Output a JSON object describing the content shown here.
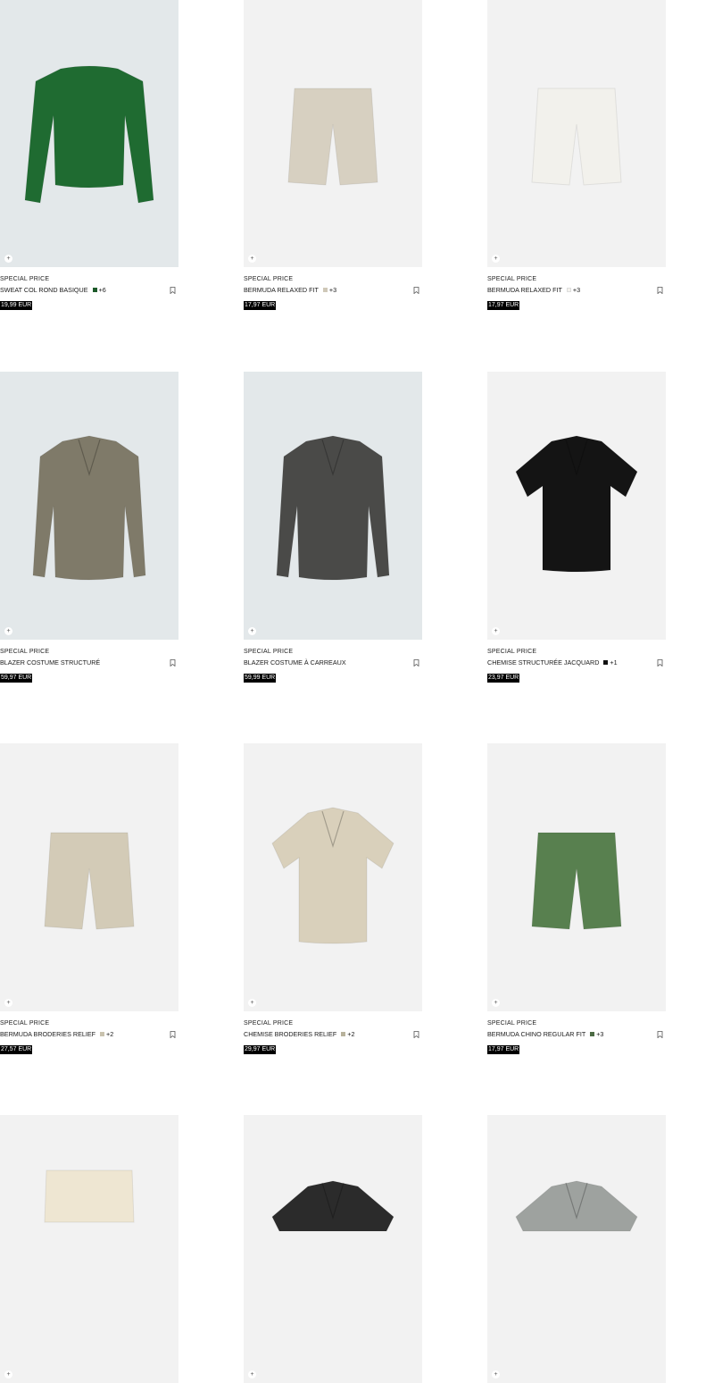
{
  "bookmark_icon": "bookmark-icon",
  "add_icon": "plus-icon",
  "products": [
    {
      "tag": "SPECIAL PRICE",
      "name": "SWEAT COL ROND BASIQUE",
      "swatch": "#1d5a2a",
      "more": "+6",
      "price": "19,99 EUR",
      "garment": "sweater",
      "color": "#1f6b31",
      "bg": "blue"
    },
    {
      "tag": "SPECIAL PRICE",
      "name": "BERMUDA RELAXED FIT",
      "swatch": "#cfc8b8",
      "more": "+3",
      "price": "17,97 EUR",
      "garment": "shorts",
      "color": "#d7d0c1",
      "bg": "grey"
    },
    {
      "tag": "SPECIAL PRICE",
      "name": "BERMUDA RELAXED FIT",
      "swatch": "#f4f3ee",
      "more": "+3",
      "price": "17,97 EUR",
      "garment": "shorts",
      "color": "#f2f1ec",
      "bg": "grey"
    },
    {
      "tag": "SPECIAL PRICE",
      "name": "BLAZER COSTUME STRUCTURÉ",
      "swatch": "",
      "more": "",
      "price": "59,97 EUR",
      "garment": "blazer",
      "color": "#7f7a69",
      "bg": "blue"
    },
    {
      "tag": "SPECIAL PRICE",
      "name": "BLAZER COSTUME À CARREAUX",
      "swatch": "",
      "more": "",
      "price": "59,99 EUR",
      "garment": "blazer",
      "color": "#4a4a48",
      "bg": "blue"
    },
    {
      "tag": "SPECIAL PRICE",
      "name": "CHEMISE STRUCTURÉE JACQUARD",
      "swatch": "#111111",
      "more": "+1",
      "price": "23,97 EUR",
      "garment": "shirt",
      "color": "#141414",
      "bg": "grey"
    },
    {
      "tag": "SPECIAL PRICE",
      "name": "BERMUDA BRODERIES RELIEF",
      "swatch": "#c9c2ae",
      "more": "+2",
      "price": "27,57 EUR",
      "garment": "shorts",
      "color": "#d3cbb7",
      "bg": "grey"
    },
    {
      "tag": "SPECIAL PRICE",
      "name": "CHEMISE BRODERIES RELIEF",
      "swatch": "#b8b29c",
      "more": "+2",
      "price": "29,97 EUR",
      "garment": "shirt",
      "color": "#d9d0bb",
      "bg": "grey"
    },
    {
      "tag": "SPECIAL PRICE",
      "name": "BERMUDA CHINO REGULAR FIT",
      "swatch": "#4c6b44",
      "more": "+3",
      "price": "17,97 EUR",
      "garment": "shorts",
      "color": "#58804f",
      "bg": "grey"
    },
    {
      "tag": "",
      "name": "",
      "swatch": "",
      "more": "",
      "price": "",
      "garment": "shorts-top",
      "color": "#eee6d2",
      "bg": "grey"
    },
    {
      "tag": "",
      "name": "",
      "swatch": "",
      "more": "",
      "price": "",
      "garment": "shirt-top",
      "color": "#2b2b2b",
      "bg": "grey"
    },
    {
      "tag": "",
      "name": "",
      "swatch": "",
      "more": "",
      "price": "",
      "garment": "shirt-top",
      "color": "#9ea29f",
      "bg": "grey"
    }
  ]
}
